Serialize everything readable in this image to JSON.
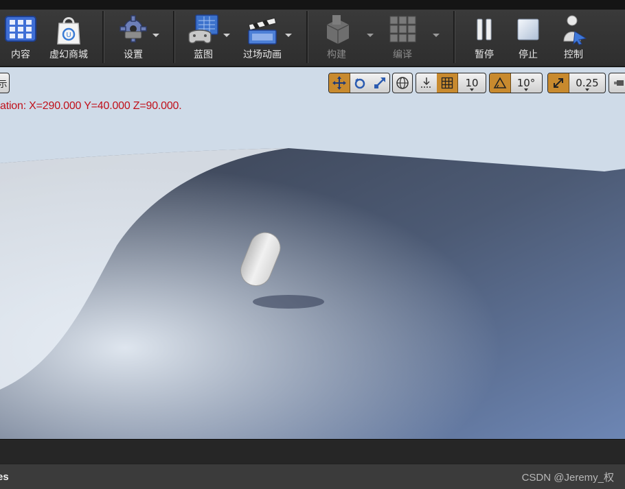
{
  "toolbar": {
    "items": [
      {
        "label": "内容",
        "icon": "content-browser-icon",
        "enabled": true
      },
      {
        "label": "虚幻商城",
        "icon": "marketplace-icon",
        "enabled": true
      },
      {
        "label": "设置",
        "icon": "settings-gear-icon",
        "enabled": true
      },
      {
        "label": "蓝图",
        "icon": "blueprint-icon",
        "enabled": true
      },
      {
        "label": "过场动画",
        "icon": "cinematics-icon",
        "enabled": true
      },
      {
        "label": "构建",
        "icon": "build-icon",
        "enabled": false
      },
      {
        "label": "编译",
        "icon": "compile-icon",
        "enabled": false
      },
      {
        "label": "暂停",
        "icon": "pause-icon",
        "enabled": true
      },
      {
        "label": "停止",
        "icon": "stop-icon",
        "enabled": true
      },
      {
        "label": "控制",
        "icon": "possess-control-icon",
        "enabled": true
      }
    ]
  },
  "viewport": {
    "left_tab_fragment": "示",
    "location_message": "ation: X=290.000 Y=40.000 Z=90.000.",
    "controls": {
      "grid_snap_value": "10",
      "rotation_snap_value": "10°",
      "scale_snap_value": "0.25"
    },
    "accent_color": "#c88a2e",
    "message_color": "#c0101a"
  },
  "status_bar": {
    "left_fragment": "es",
    "watermark": "CSDN @Jeremy_权"
  }
}
